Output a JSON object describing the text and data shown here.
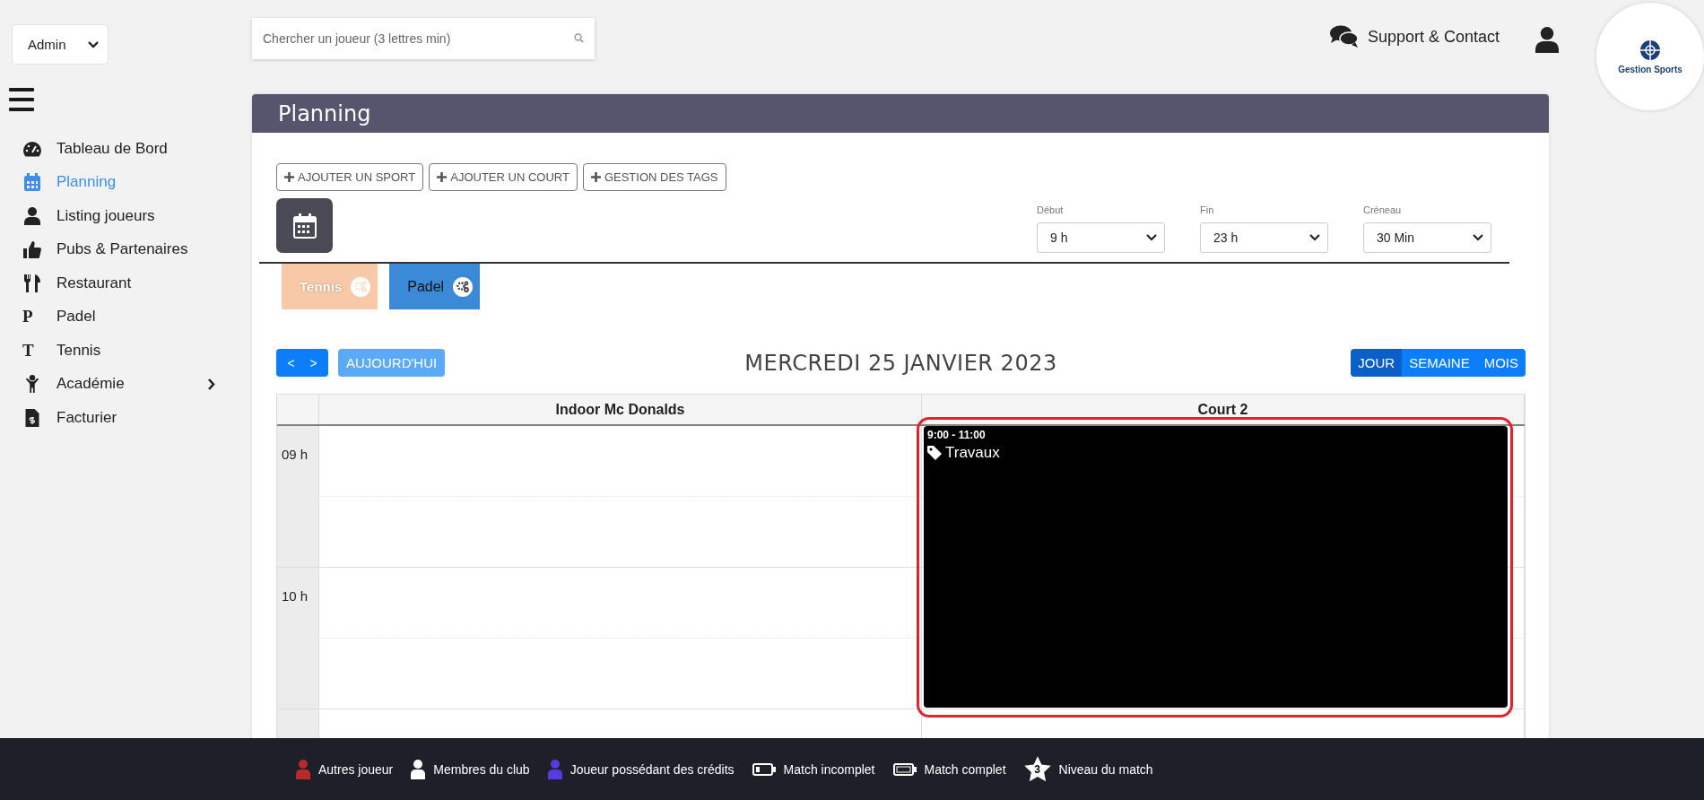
{
  "role_select": {
    "value": "Admin"
  },
  "sidebar": {
    "items": [
      {
        "label": "Tableau de Bord",
        "kind": "gauge",
        "selected": false
      },
      {
        "label": "Planning",
        "kind": "calendar",
        "selected": true
      },
      {
        "label": "Listing joueurs",
        "kind": "user",
        "selected": false
      },
      {
        "label": "Pubs & Partenaires",
        "kind": "thumb",
        "selected": false
      },
      {
        "label": "Restaurant",
        "kind": "cutlery",
        "selected": false
      },
      {
        "label": "Padel",
        "kind": "glyph",
        "glyph": "P",
        "selected": false
      },
      {
        "label": "Tennis",
        "kind": "glyph",
        "glyph": "T",
        "selected": false
      },
      {
        "label": "Académie",
        "kind": "child",
        "selected": false,
        "has_submenu": true
      },
      {
        "label": "Facturier",
        "kind": "invoice",
        "selected": false
      }
    ]
  },
  "search": {
    "placeholder": "Chercher un joueur (3 lettres min)"
  },
  "support": {
    "label": "Support & Contact"
  },
  "logo": {
    "text": "Gestion Sports"
  },
  "panel": {
    "title": "Planning",
    "actions": [
      "AJOUTER UN SPORT",
      "AJOUTER UN COURT",
      "GESTION DES TAGS"
    ],
    "filters": [
      {
        "label": "Début",
        "value": "9 h"
      },
      {
        "label": "Fin",
        "value": "23 h"
      },
      {
        "label": "Créneau",
        "value": "30 Min"
      }
    ],
    "sport_tabs": [
      {
        "label": "Tennis",
        "selected": false
      },
      {
        "label": "Padel",
        "selected": true
      }
    ]
  },
  "calendar": {
    "prev": "<",
    "next": ">",
    "today": "AUJOURD'HUI",
    "date": "MERCREDI 25 JANVIER 2023",
    "views": [
      {
        "label": "JOUR",
        "selected": true
      },
      {
        "label": "SEMAINE",
        "selected": false
      },
      {
        "label": "MOIS",
        "selected": false
      }
    ],
    "time_slots": [
      "09 h",
      "10 h"
    ],
    "columns": [
      {
        "name": "Indoor Mc Donalds"
      },
      {
        "name": "Court 2",
        "events": [
          {
            "time": "9:00 - 11:00",
            "title": "Travaux",
            "highlighted": true
          }
        ]
      }
    ]
  },
  "legend": [
    {
      "kind": "player",
      "color": "#b52a2a",
      "label": "Autres joueur"
    },
    {
      "kind": "player",
      "color": "#ffffff",
      "label": "Membres du club"
    },
    {
      "kind": "player",
      "color": "#5a3be0",
      "label": "Joueur possédant des crédits"
    },
    {
      "kind": "battery-low",
      "label": "Match incomplet"
    },
    {
      "kind": "battery-full",
      "label": "Match complet"
    },
    {
      "kind": "star",
      "value": "3",
      "label": "Niveau du match"
    }
  ]
}
